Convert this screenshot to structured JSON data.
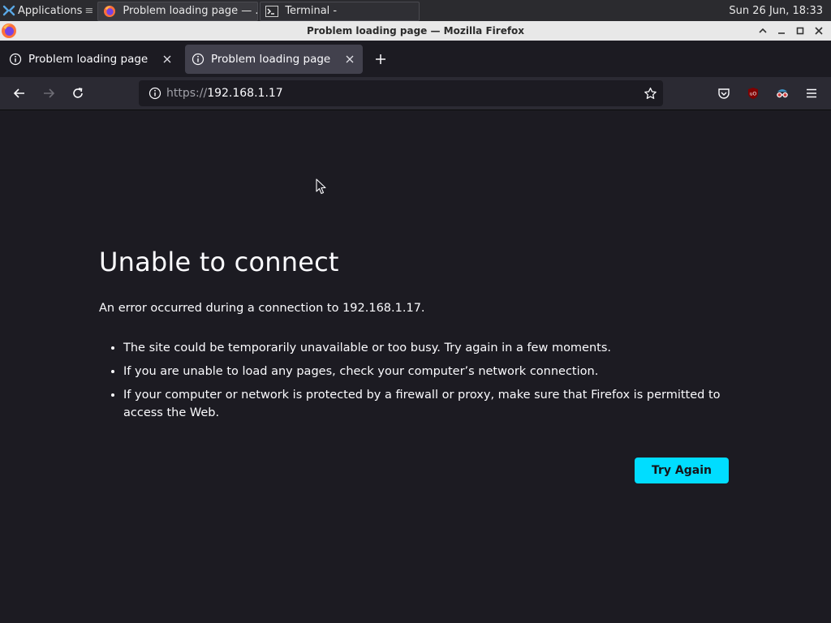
{
  "panel": {
    "apps_label": "Applications",
    "tasks": [
      {
        "label": "Problem loading page — ...",
        "icon": "firefox-icon"
      },
      {
        "label": "Terminal -",
        "icon": "terminal-icon"
      }
    ],
    "clock": "Sun 26 Jun, 18:33"
  },
  "window": {
    "title": "Problem loading page — Mozilla Firefox"
  },
  "tabs": [
    {
      "label": "Problem loading page",
      "active": false
    },
    {
      "label": "Problem loading page",
      "active": true
    }
  ],
  "urlbar": {
    "scheme": "https://",
    "host": "192.168.1.17"
  },
  "error": {
    "title": "Unable to connect",
    "description": "An error occurred during a connection to 192.168.1.17.",
    "items": [
      "The site could be temporarily unavailable or too busy. Try again in a few moments.",
      "If you are unable to load any pages, check your computer’s network connection.",
      "If your computer or network is protected by a firewall or proxy, make sure that Firefox is permitted to access the Web."
    ],
    "button_label": "Try Again"
  },
  "colors": {
    "accent": "#00ddff",
    "background": "#1c1b22",
    "toolbar": "#2b2a33"
  }
}
